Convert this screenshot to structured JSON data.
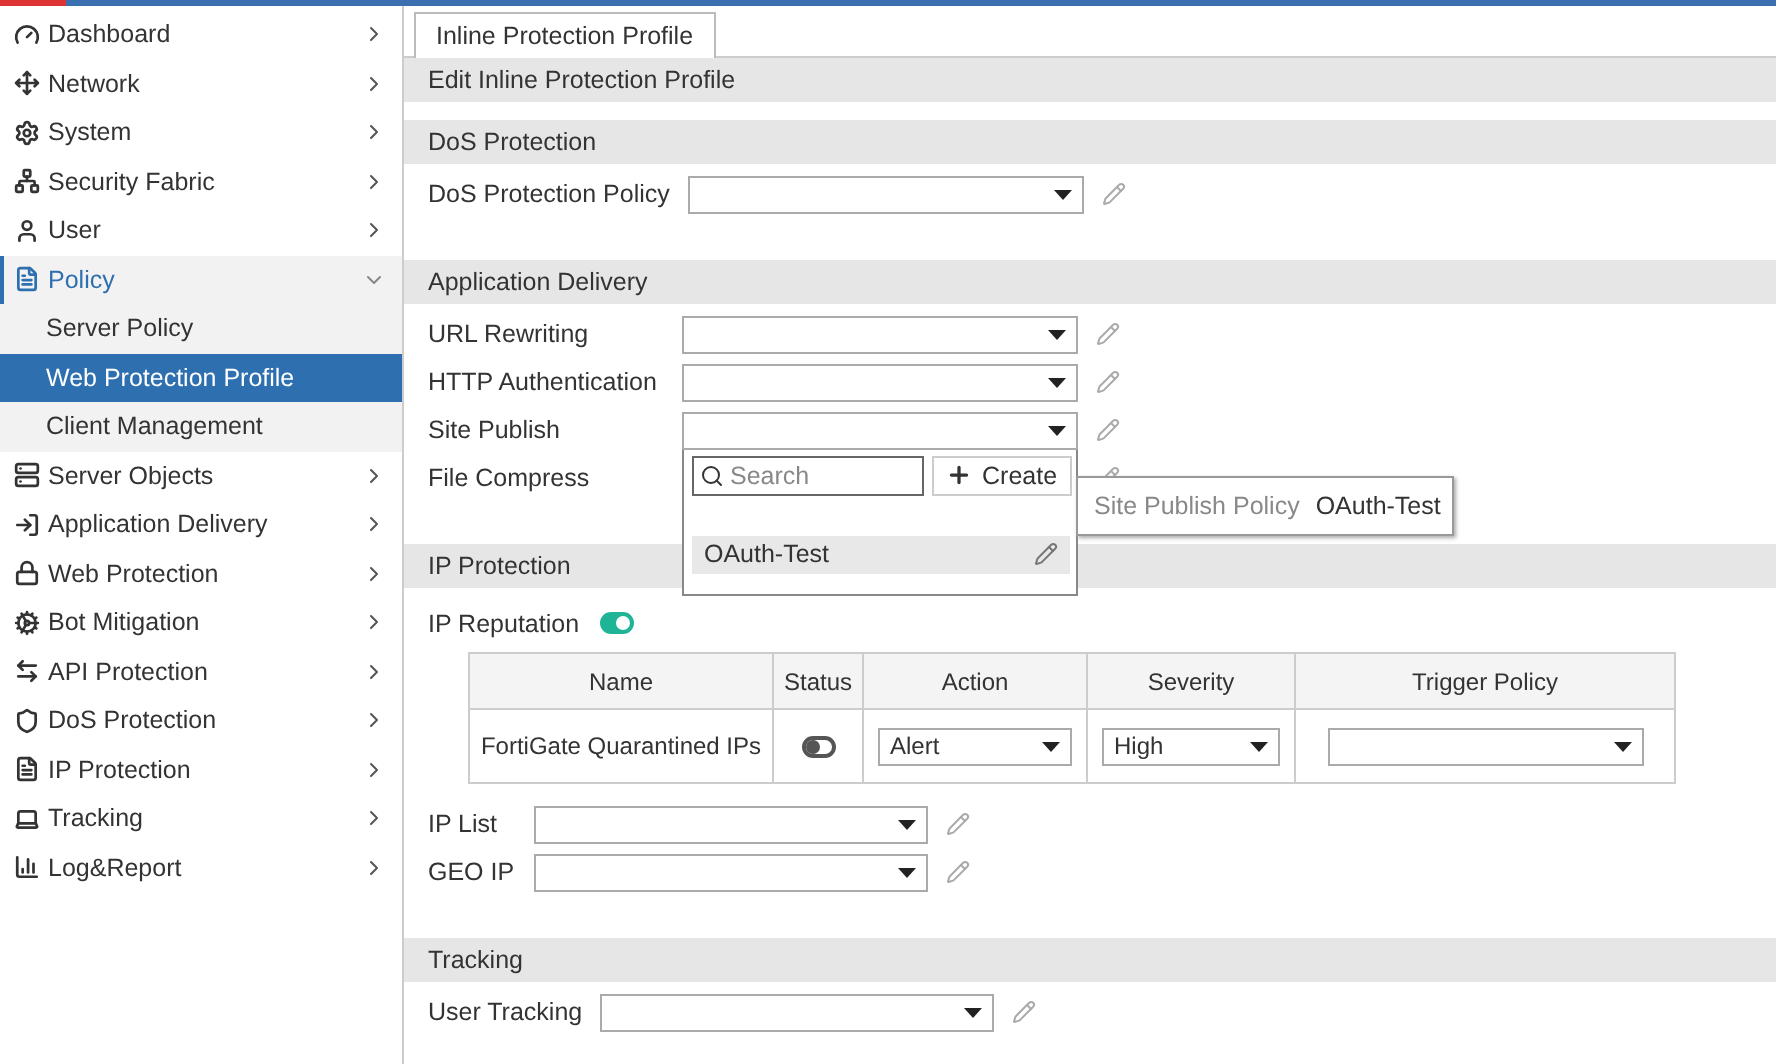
{
  "sidebar": {
    "items": [
      {
        "label": "Dashboard",
        "expanded": false
      },
      {
        "label": "Network",
        "expanded": false
      },
      {
        "label": "System",
        "expanded": false
      },
      {
        "label": "Security Fabric",
        "expanded": false
      },
      {
        "label": "User",
        "expanded": false
      },
      {
        "label": "Policy",
        "expanded": true,
        "children": [
          {
            "label": "Server Policy",
            "selected": false
          },
          {
            "label": "Web Protection Profile",
            "selected": true
          },
          {
            "label": "Client Management",
            "selected": false
          }
        ]
      },
      {
        "label": "Server Objects",
        "expanded": false
      },
      {
        "label": "Application Delivery",
        "expanded": false
      },
      {
        "label": "Web Protection",
        "expanded": false
      },
      {
        "label": "Bot Mitigation",
        "expanded": false
      },
      {
        "label": "API Protection",
        "expanded": false
      },
      {
        "label": "DoS Protection",
        "expanded": false
      },
      {
        "label": "IP Protection",
        "expanded": false
      },
      {
        "label": "Tracking",
        "expanded": false
      },
      {
        "label": "Log&Report",
        "expanded": false
      }
    ]
  },
  "tabs": [
    {
      "label": "Inline Protection Profile",
      "selected": true
    }
  ],
  "title": "Edit Inline Protection Profile",
  "sections": [
    {
      "title": "DoS Protection",
      "fields": [
        {
          "kind": "select",
          "label": "DoS Protection Policy"
        }
      ]
    },
    {
      "title": "Application Delivery",
      "fields": [
        {
          "kind": "select",
          "label": "URL Rewriting"
        },
        {
          "kind": "select",
          "label": "HTTP Authentication"
        },
        {
          "kind": "select",
          "label": "Site Publish",
          "dropdown": {
            "search_placeholder": "Search",
            "create_label": "Create",
            "options": [
              {
                "label": "OAuth-Test",
                "selected": true
              }
            ],
            "tooltip": {
              "label": "Site Publish Policy",
              "value": "OAuth-Test"
            }
          }
        },
        {
          "kind": "covered_select",
          "label": "File Compress"
        }
      ]
    },
    {
      "title": "IP Protection",
      "fields": [
        {
          "kind": "toggle",
          "label": "IP Reputation",
          "on": true
        },
        {
          "kind": "table",
          "columns": [
            "Name",
            "Status",
            "Action",
            "Severity",
            "Trigger Policy"
          ],
          "rows": [
            {
              "name": "FortiGate Quarantined IPs",
              "on": false,
              "action": "Alert",
              "severity": "High"
            }
          ]
        },
        {
          "kind": "select",
          "label": "IP List"
        },
        {
          "kind": "select",
          "label": "GEO IP"
        }
      ]
    },
    {
      "title": "Tracking",
      "fields": [
        {
          "kind": "select",
          "label": "User Tracking"
        }
      ]
    }
  ]
}
